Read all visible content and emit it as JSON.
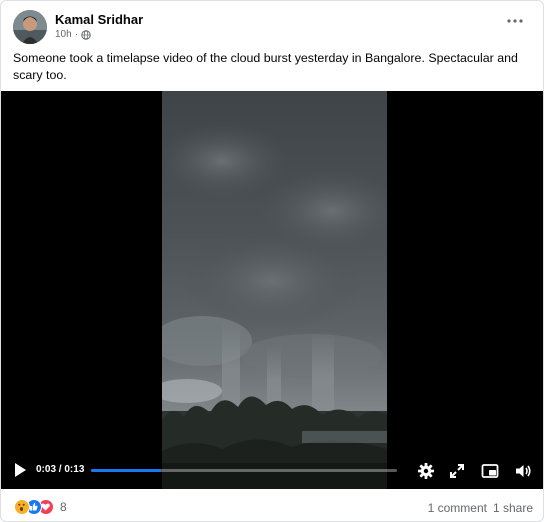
{
  "post": {
    "author": "Kamal Sridhar",
    "timestamp": "10h",
    "separator": "·",
    "privacy_icon": "globe-icon",
    "more_icon": "more-options-icon",
    "caption": "Someone took a timelapse video of the cloud burst yesterday in Bangalore.  Spectacular and scary too."
  },
  "video": {
    "current_time": "0:03",
    "total_time": "0:13",
    "time_separator": " / ",
    "progress": 0.23,
    "accent_color": "#1877f2",
    "icons": [
      "play-icon",
      "settings-icon",
      "fullscreen-icon",
      "picture-in-picture-icon",
      "volume-icon"
    ]
  },
  "footer": {
    "reaction_icons": [
      "wow-reaction-icon",
      "like-reaction-icon",
      "love-reaction-icon"
    ],
    "reaction_count": "8",
    "comments": "1 comment",
    "shares": "1 share"
  }
}
